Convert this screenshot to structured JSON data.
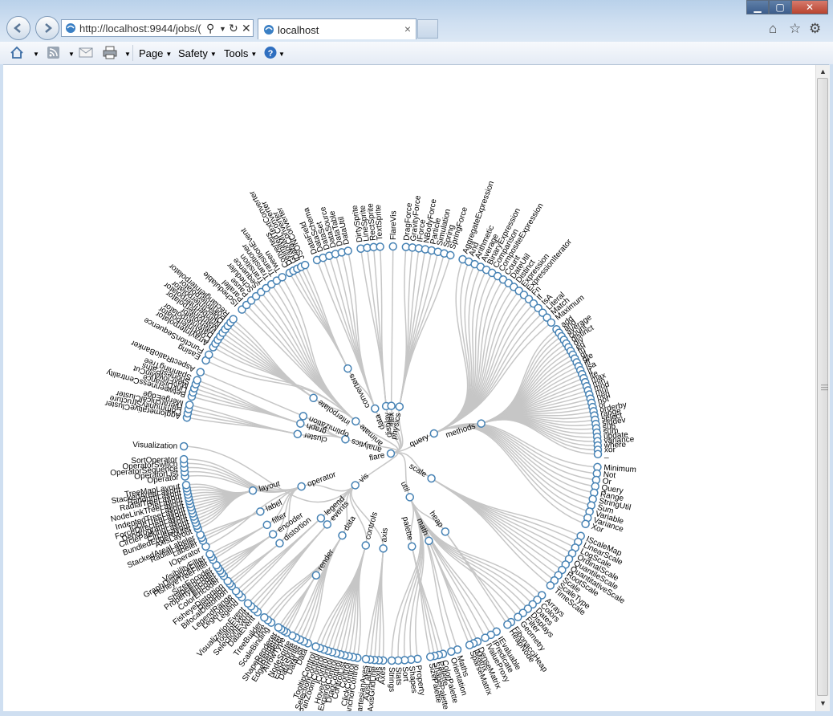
{
  "browser": {
    "address_url": "http://localhost:9944/jobs/(",
    "tab_title": "localhost",
    "colors": {
      "link": "#c6c6c6",
      "node_stroke": "#4682b4",
      "node_fill": "#ffffff"
    }
  },
  "commandbar": {
    "page_label": "Page",
    "safety_label": "Safety",
    "tools_label": "Tools"
  },
  "icons": [
    "back-icon",
    "forward-icon",
    "site-favicon",
    "search-icon",
    "refresh-icon",
    "stop-icon",
    "close-icon",
    "home-icon",
    "favorites-star-icon",
    "gear-icon",
    "rss-feed-icon",
    "read-mail-icon",
    "print-icon",
    "help-icon"
  ],
  "tree": {
    "name": "flare",
    "children": [
      {
        "name": "analytics",
        "children": [
          {
            "name": "cluster",
            "children": [
              {
                "name": "AgglomerativeCluster"
              },
              {
                "name": "CommunityStructure"
              },
              {
                "name": "HierarchicalCluster"
              },
              {
                "name": "MergeEdge"
              }
            ]
          },
          {
            "name": "graph",
            "children": [
              {
                "name": "BetweennessCentrality"
              },
              {
                "name": "LinkDistance"
              },
              {
                "name": "MaxFlowMinCut"
              },
              {
                "name": "ShortestPaths"
              },
              {
                "name": "SpanningTree"
              }
            ]
          },
          {
            "name": "optimization",
            "children": [
              {
                "name": "AspectRatioBanker"
              }
            ]
          }
        ]
      },
      {
        "name": "animate",
        "children": [
          {
            "name": "Easing"
          },
          {
            "name": "FunctionSequence"
          },
          {
            "name": "interpolate",
            "children": [
              {
                "name": "ArrayInterpolator"
              },
              {
                "name": "ColorInterpolator"
              },
              {
                "name": "DateInterpolator"
              },
              {
                "name": "Interpolator"
              },
              {
                "name": "MatrixInterpolator"
              },
              {
                "name": "NumberInterpolator"
              },
              {
                "name": "ObjectInterpolator"
              },
              {
                "name": "PointInterpolator"
              },
              {
                "name": "RectangleInterpolator"
              }
            ]
          },
          {
            "name": "ISchedulable"
          },
          {
            "name": "Parallel"
          },
          {
            "name": "Pause"
          },
          {
            "name": "Scheduler"
          },
          {
            "name": "Sequence"
          },
          {
            "name": "Transition"
          },
          {
            "name": "Transitioner"
          },
          {
            "name": "TransitionEvent"
          },
          {
            "name": "Tween"
          }
        ]
      },
      {
        "name": "data",
        "children": [
          {
            "name": "converters",
            "children": [
              {
                "name": "Converters"
              },
              {
                "name": "DelimitedTextConverter"
              },
              {
                "name": "GraphMLConverter"
              },
              {
                "name": "IDataConverter"
              },
              {
                "name": "JSONConverter"
              }
            ]
          },
          {
            "name": "DataField"
          },
          {
            "name": "DataSchema"
          },
          {
            "name": "DataSet"
          },
          {
            "name": "DataSource"
          },
          {
            "name": "DataTable"
          },
          {
            "name": "DataUtil"
          }
        ]
      },
      {
        "name": "display",
        "children": [
          {
            "name": "DirtySprite"
          },
          {
            "name": "LineSprite"
          },
          {
            "name": "RectSprite"
          },
          {
            "name": "TextSprite"
          }
        ]
      },
      {
        "name": "flex",
        "children": [
          {
            "name": "FlareVis"
          }
        ]
      },
      {
        "name": "physics",
        "children": [
          {
            "name": "DragForce"
          },
          {
            "name": "GravityForce"
          },
          {
            "name": "IForce"
          },
          {
            "name": "NBodyForce"
          },
          {
            "name": "Particle"
          },
          {
            "name": "Simulation"
          },
          {
            "name": "Spring"
          },
          {
            "name": "SpringForce"
          }
        ]
      },
      {
        "name": "query",
        "children": [
          {
            "name": "AggregateExpression"
          },
          {
            "name": "And"
          },
          {
            "name": "Arithmetic"
          },
          {
            "name": "Average"
          },
          {
            "name": "BinaryExpression"
          },
          {
            "name": "Comparison"
          },
          {
            "name": "CompositeExpression"
          },
          {
            "name": "Count"
          },
          {
            "name": "DateUtil"
          },
          {
            "name": "Distinct"
          },
          {
            "name": "Expression"
          },
          {
            "name": "ExpressionIterator"
          },
          {
            "name": "Fn"
          },
          {
            "name": "If"
          },
          {
            "name": "IsA"
          },
          {
            "name": "Literal"
          },
          {
            "name": "Match"
          },
          {
            "name": "Maximum"
          },
          {
            "name": "methods",
            "children": [
              {
                "name": "add"
              },
              {
                "name": "and"
              },
              {
                "name": "average"
              },
              {
                "name": "count"
              },
              {
                "name": "distinct"
              },
              {
                "name": "div"
              },
              {
                "name": "eq"
              },
              {
                "name": "fn"
              },
              {
                "name": "gt"
              },
              {
                "name": "gte"
              },
              {
                "name": "iff"
              },
              {
                "name": "isa"
              },
              {
                "name": "lt"
              },
              {
                "name": "lte"
              },
              {
                "name": "max"
              },
              {
                "name": "min"
              },
              {
                "name": "mod"
              },
              {
                "name": "mul"
              },
              {
                "name": "neq"
              },
              {
                "name": "not"
              },
              {
                "name": "or"
              },
              {
                "name": "orderby"
              },
              {
                "name": "range"
              },
              {
                "name": "select"
              },
              {
                "name": "stddev"
              },
              {
                "name": "sub"
              },
              {
                "name": "sum"
              },
              {
                "name": "update"
              },
              {
                "name": "variance"
              },
              {
                "name": "where"
              },
              {
                "name": "xor"
              },
              {
                "name": "_"
              }
            ]
          },
          {
            "name": "Minimum"
          },
          {
            "name": "Not"
          },
          {
            "name": "Or"
          },
          {
            "name": "Query"
          },
          {
            "name": "Range"
          },
          {
            "name": "StringUtil"
          },
          {
            "name": "Sum"
          },
          {
            "name": "Variable"
          },
          {
            "name": "Variance"
          },
          {
            "name": "Xor"
          }
        ]
      },
      {
        "name": "scale",
        "children": [
          {
            "name": "IScaleMap"
          },
          {
            "name": "LinearScale"
          },
          {
            "name": "LogScale"
          },
          {
            "name": "OrdinalScale"
          },
          {
            "name": "QuantileScale"
          },
          {
            "name": "QuantitativeScale"
          },
          {
            "name": "RootScale"
          },
          {
            "name": "Scale"
          },
          {
            "name": "ScaleType"
          },
          {
            "name": "TimeScale"
          }
        ]
      },
      {
        "name": "util",
        "children": [
          {
            "name": "Arrays"
          },
          {
            "name": "Colors"
          },
          {
            "name": "Dates"
          },
          {
            "name": "Displays"
          },
          {
            "name": "Filter"
          },
          {
            "name": "Geometry"
          },
          {
            "name": "heap",
            "children": [
              {
                "name": "FibonacciHeap"
              },
              {
                "name": "HeapNode"
              }
            ]
          },
          {
            "name": "IEvaluable"
          },
          {
            "name": "IPredicate"
          },
          {
            "name": "IValueProxy"
          },
          {
            "name": "math",
            "children": [
              {
                "name": "DenseMatrix"
              },
              {
                "name": "IMatrix"
              },
              {
                "name": "SparseMatrix"
              }
            ]
          },
          {
            "name": "Maths"
          },
          {
            "name": "Orientation"
          },
          {
            "name": "palette",
            "children": [
              {
                "name": "ColorPalette"
              },
              {
                "name": "Palette"
              },
              {
                "name": "ShapePalette"
              },
              {
                "name": "SizePalette"
              }
            ]
          },
          {
            "name": "Property"
          },
          {
            "name": "Shapes"
          },
          {
            "name": "Sort"
          },
          {
            "name": "Stats"
          },
          {
            "name": "Strings"
          }
        ]
      },
      {
        "name": "vis",
        "children": [
          {
            "name": "axis",
            "children": [
              {
                "name": "Axes"
              },
              {
                "name": "Axis"
              },
              {
                "name": "AxisGridLine"
              },
              {
                "name": "AxisLabel"
              },
              {
                "name": "CartesianAxes"
              }
            ]
          },
          {
            "name": "controls",
            "children": [
              {
                "name": "AnchorControl"
              },
              {
                "name": "ClickControl"
              },
              {
                "name": "Control"
              },
              {
                "name": "ControlList"
              },
              {
                "name": "DragControl"
              },
              {
                "name": "ExpandControl"
              },
              {
                "name": "HoverControl"
              },
              {
                "name": "IControl"
              },
              {
                "name": "PanZoomControl"
              },
              {
                "name": "SelectionControl"
              },
              {
                "name": "TooltipControl"
              }
            ]
          },
          {
            "name": "data",
            "children": [
              {
                "name": "Data"
              },
              {
                "name": "DataList"
              },
              {
                "name": "DataSprite"
              },
              {
                "name": "EdgeSprite"
              },
              {
                "name": "NodeSprite"
              },
              {
                "name": "render",
                "children": [
                  {
                    "name": "ArrowType"
                  },
                  {
                    "name": "EdgeRenderer"
                  },
                  {
                    "name": "IRenderer"
                  },
                  {
                    "name": "ShapeRenderer"
                  }
                ]
              },
              {
                "name": "ScaleBinding"
              },
              {
                "name": "Tree"
              },
              {
                "name": "TreeBuilder"
              }
            ]
          },
          {
            "name": "events",
            "children": [
              {
                "name": "DataEvent"
              },
              {
                "name": "SelectionEvent"
              },
              {
                "name": "TooltipEvent"
              },
              {
                "name": "VisualizationEvent"
              }
            ]
          },
          {
            "name": "legend",
            "children": [
              {
                "name": "Legend"
              },
              {
                "name": "LegendItem"
              },
              {
                "name": "LegendRange"
              }
            ]
          },
          {
            "name": "operator",
            "children": [
              {
                "name": "distortion",
                "children": [
                  {
                    "name": "BifocalDistortion"
                  },
                  {
                    "name": "Distortion"
                  },
                  {
                    "name": "FisheyeDistortion"
                  }
                ]
              },
              {
                "name": "encoder",
                "children": [
                  {
                    "name": "ColorEncoder"
                  },
                  {
                    "name": "Encoder"
                  },
                  {
                    "name": "PropertyEncoder"
                  },
                  {
                    "name": "ShapeEncoder"
                  },
                  {
                    "name": "SizeEncoder"
                  }
                ]
              },
              {
                "name": "filter",
                "children": [
                  {
                    "name": "FisheyeTreeFilter"
                  },
                  {
                    "name": "GraphDistanceFilter"
                  },
                  {
                    "name": "VisibilityFilter"
                  }
                ]
              },
              {
                "name": "IOperator"
              },
              {
                "name": "label",
                "children": [
                  {
                    "name": "Labeler"
                  },
                  {
                    "name": "RadialLabeler"
                  },
                  {
                    "name": "StackedAreaLabeler"
                  }
                ]
              },
              {
                "name": "layout",
                "children": [
                  {
                    "name": "AxisLayout"
                  },
                  {
                    "name": "BundledEdgeRouter"
                  },
                  {
                    "name": "CircleLayout"
                  },
                  {
                    "name": "CirclePackingLayout"
                  },
                  {
                    "name": "DendrogramLayout"
                  },
                  {
                    "name": "ForceDirectedLayout"
                  },
                  {
                    "name": "IcicleTreeLayout"
                  },
                  {
                    "name": "IndentedTreeLayout"
                  },
                  {
                    "name": "Layout"
                  },
                  {
                    "name": "NodeLinkTreeLayout"
                  },
                  {
                    "name": "PieLayout"
                  },
                  {
                    "name": "RadialTreeLayout"
                  },
                  {
                    "name": "RandomLayout"
                  },
                  {
                    "name": "StackedAreaLayout"
                  },
                  {
                    "name": "TreeMapLayout"
                  }
                ]
              },
              {
                "name": "Operator"
              },
              {
                "name": "OperatorList"
              },
              {
                "name": "OperatorSequence"
              },
              {
                "name": "OperatorSwitch"
              },
              {
                "name": "SortOperator"
              }
            ]
          },
          {
            "name": "Visualization"
          }
        ]
      }
    ]
  }
}
